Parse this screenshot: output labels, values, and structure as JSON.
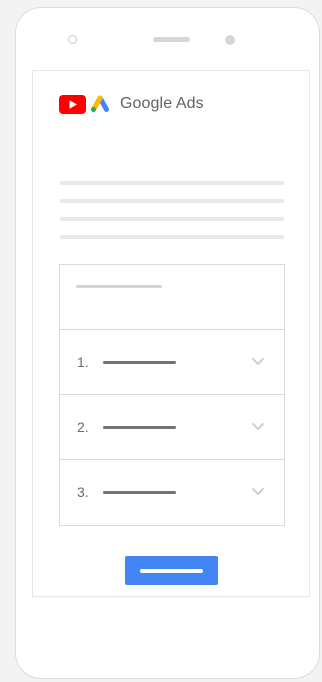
{
  "brand": {
    "name": "Google Ads",
    "youtube_icon": "youtube-icon",
    "ads_icon": "google-ads-icon"
  },
  "colors": {
    "youtube_red": "#ff0000",
    "ads_blue": "#4285f4",
    "ads_yellow": "#fbbc04",
    "ads_green": "#34a853",
    "button_blue": "#4285f4",
    "brand_text": "#5f6368"
  },
  "accordion": {
    "items": [
      {
        "number": "1.",
        "icon": "chevron-down-icon"
      },
      {
        "number": "2.",
        "icon": "chevron-down-icon"
      },
      {
        "number": "3.",
        "icon": "chevron-down-icon"
      }
    ]
  }
}
